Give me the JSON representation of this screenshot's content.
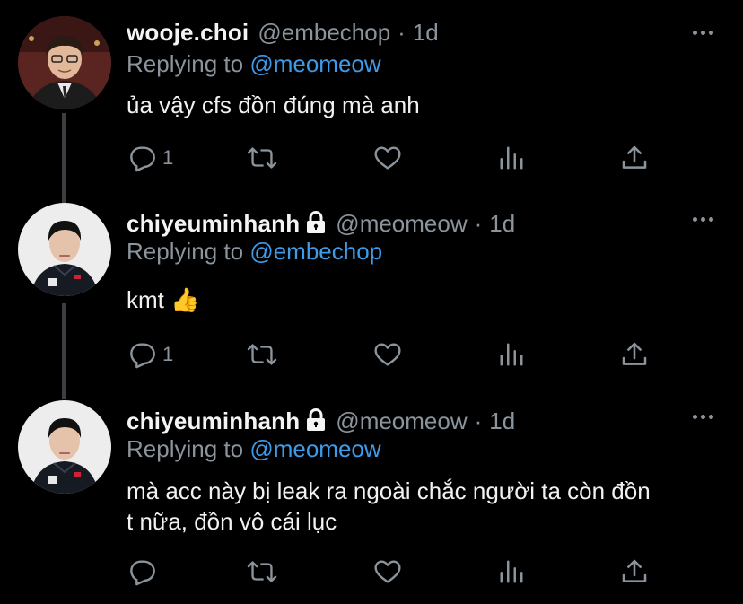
{
  "tweets": [
    {
      "display_name": "wooje.choi",
      "handle": "@embechop",
      "time": "1d",
      "protected": false,
      "replying_prefix": "Replying to",
      "replying_to": "@meomeow",
      "text_lines": [
        "ủa vậy cfs đồn đúng mà anh"
      ],
      "reply_count": "1"
    },
    {
      "display_name": "chiyeuminhanh",
      "handle": "@meomeow",
      "time": "1d",
      "protected": true,
      "replying_prefix": "Replying to",
      "replying_to": "@embechop",
      "text_lines": [
        "kmt 👍"
      ],
      "reply_count": "1"
    },
    {
      "display_name": "chiyeuminhanh",
      "handle": "@meomeow",
      "time": "1d",
      "protected": true,
      "replying_prefix": "Replying to",
      "replying_to": "@meomeow",
      "text_lines": [
        "mà acc này bị leak ra ngoài chắc người ta còn đồn",
        "t nữa, đồn vô cái lục"
      ],
      "reply_count": ""
    }
  ],
  "separator": "·",
  "icons": [
    "reply-icon",
    "retweet-icon",
    "like-icon",
    "analytics-icon",
    "share-icon",
    "more-icon",
    "lock-icon"
  ],
  "colors": {
    "background": "#000000",
    "text": "#f1f1f1",
    "muted": "#8b949c",
    "link": "#3d9be9",
    "thread_line": "#3b3f44"
  }
}
